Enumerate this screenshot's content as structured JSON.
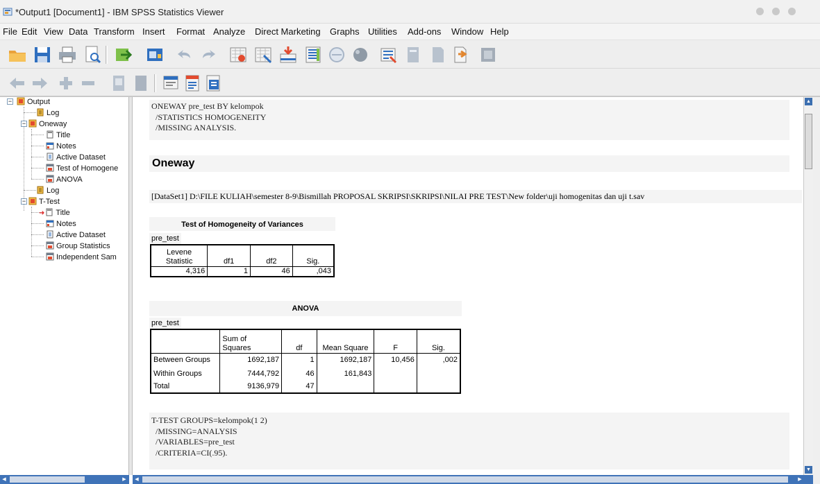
{
  "window": {
    "title": "*Output1 [Document1] - IBM SPSS Statistics Viewer"
  },
  "menu": [
    "File",
    "Edit",
    "View",
    "Data",
    "Transform",
    "Insert",
    "Format",
    "Analyze",
    "Direct Marketing",
    "Graphs",
    "Utilities",
    "Add-ons",
    "Window",
    "Help"
  ],
  "outline": {
    "root": "Output",
    "log1": "Log",
    "oneway": "Oneway",
    "oneway_items": [
      "Title",
      "Notes",
      "Active Dataset",
      "Test of Homogene",
      "ANOVA"
    ],
    "log2": "Log",
    "ttest": "T-Test",
    "ttest_items": [
      "Title",
      "Notes",
      "Active Dataset",
      "Group Statistics",
      "Independent Sam"
    ]
  },
  "content": {
    "syntax1": [
      "ONEWAY pre_test BY kelompok",
      "  /STATISTICS HOMOGENEITY",
      "  /MISSING ANALYSIS."
    ],
    "heading": "Oneway",
    "dataset_line": "[DataSet1] D:\\FILE KULIAH\\semester 8-9\\Bismillah PROPOSAL SKRIPSI\\SKRIPSI\\NILAI PRE TEST\\New folder\\uji homogenitas dan uji t.sav",
    "homog": {
      "title": "Test of Homogeneity of Variances",
      "variable": "pre_test",
      "headers": [
        "Levene\nStatistic",
        "df1",
        "df2",
        "Sig."
      ],
      "values": [
        "4,316",
        "1",
        "46",
        ",043"
      ]
    },
    "anova": {
      "title": "ANOVA",
      "variable": "pre_test",
      "headers": [
        "",
        "Sum of\nSquares",
        "df",
        "Mean Square",
        "F",
        "Sig."
      ],
      "rows": [
        [
          "Between Groups",
          "1692,187",
          "1",
          "1692,187",
          "10,456",
          ",002"
        ],
        [
          "Within Groups",
          "7444,792",
          "46",
          "161,843",
          "",
          ""
        ],
        [
          "Total",
          "9136,979",
          "47",
          "",
          "",
          ""
        ]
      ]
    },
    "syntax2": [
      "T-TEST GROUPS=kelompok(1 2)",
      "  /MISSING=ANALYSIS",
      "  /VARIABLES=pre_test",
      "  /CRITERIA=CI(.95)."
    ]
  }
}
